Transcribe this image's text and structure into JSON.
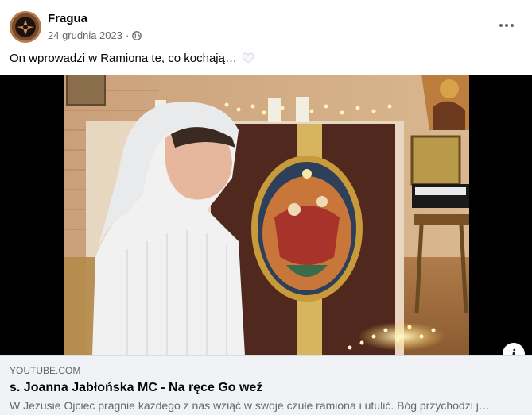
{
  "post": {
    "author": "Fragua",
    "date": "24 grudnia 2023",
    "separator": "·",
    "privacy_icon": "globe-icon",
    "more_icon": "more-horizontal-icon",
    "caption": "On wprowadzi w Ramiona te, co kochają…",
    "caption_emoji": "white-heart-icon"
  },
  "media": {
    "image": "video-thumbnail",
    "info_icon": "info-icon",
    "info_label": "i"
  },
  "link_preview": {
    "domain": "YOUTUBE.COM",
    "title": "s. Joanna Jabłońska MC - Na ręce Go weź",
    "description": "W Jezusie Ojciec pragnie każdego z nas wziąć w swoje czułe ramiona i utulić. Bóg przychodzi j…"
  },
  "colors": {
    "background": "#ffffff",
    "secondary_text": "#65676b",
    "link_box_bg": "#f0f2f5"
  }
}
